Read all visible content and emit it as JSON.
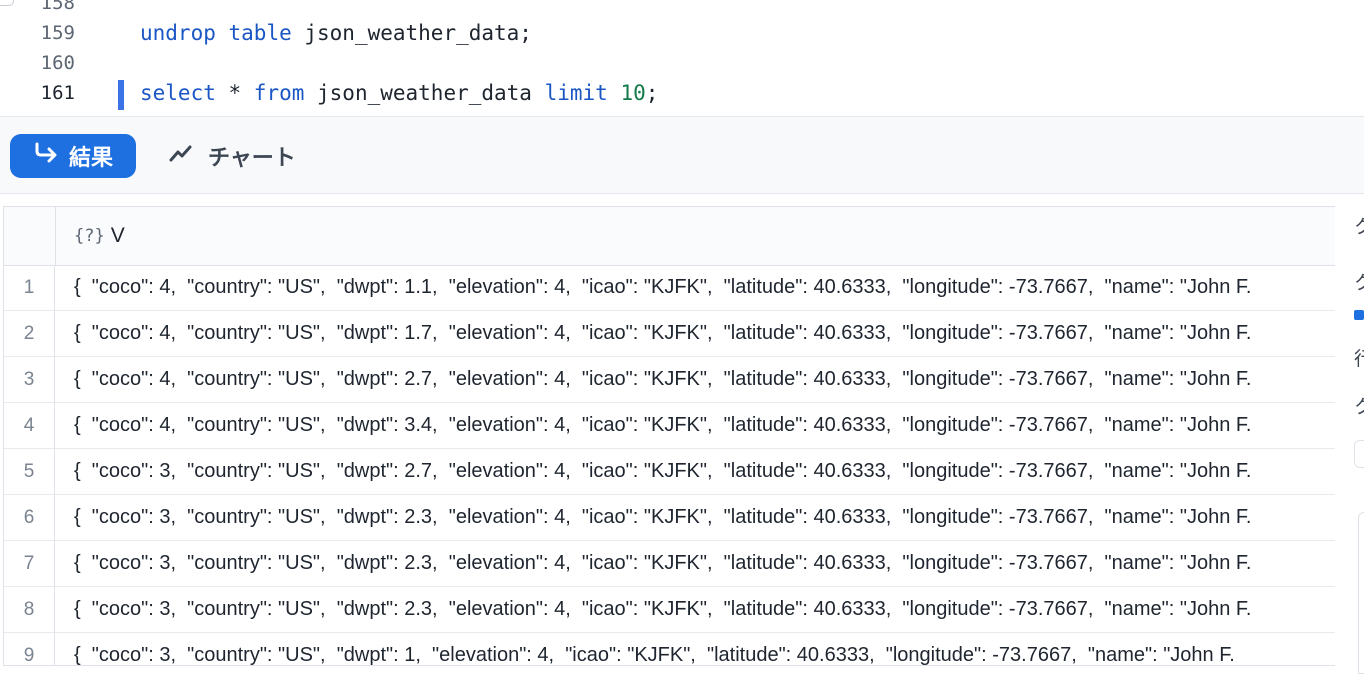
{
  "editor": {
    "lines": [
      {
        "num": "158",
        "tokens": []
      },
      {
        "num": "159",
        "tokens": [
          {
            "text": "undrop",
            "cls": "kw"
          },
          {
            "text": " "
          },
          {
            "text": "table",
            "cls": "kw"
          },
          {
            "text": " json_weather_data;"
          }
        ]
      },
      {
        "num": "160",
        "tokens": []
      },
      {
        "num": "161",
        "tokens": [
          {
            "text": "select",
            "cls": "kw"
          },
          {
            "text": " * "
          },
          {
            "text": "from",
            "cls": "kw"
          },
          {
            "text": " json_weather_data "
          },
          {
            "text": "limit",
            "cls": "kw"
          },
          {
            "text": " "
          },
          {
            "text": "10",
            "cls": "num"
          },
          {
            "text": ";"
          }
        ]
      }
    ],
    "active_line": "161"
  },
  "toolbar": {
    "results_label": "結果",
    "results_icon": "return-arrow-icon",
    "chart_label": "チャート",
    "chart_icon": "trend-line-icon"
  },
  "grid": {
    "column": {
      "type_icon": "{?}",
      "name": "V"
    },
    "rows": [
      {
        "num": "1",
        "value": "{  \"coco\": 4,  \"country\": \"US\",  \"dwpt\": 1.1,  \"elevation\": 4,  \"icao\": \"KJFK\",  \"latitude\": 40.6333,  \"longitude\": -73.7667,  \"name\": \"John F."
      },
      {
        "num": "2",
        "value": "{  \"coco\": 4,  \"country\": \"US\",  \"dwpt\": 1.7,  \"elevation\": 4,  \"icao\": \"KJFK\",  \"latitude\": 40.6333,  \"longitude\": -73.7667,  \"name\": \"John F."
      },
      {
        "num": "3",
        "value": "{  \"coco\": 4,  \"country\": \"US\",  \"dwpt\": 2.7,  \"elevation\": 4,  \"icao\": \"KJFK\",  \"latitude\": 40.6333,  \"longitude\": -73.7667,  \"name\": \"John F."
      },
      {
        "num": "4",
        "value": "{  \"coco\": 4,  \"country\": \"US\",  \"dwpt\": 3.4,  \"elevation\": 4,  \"icao\": \"KJFK\",  \"latitude\": 40.6333,  \"longitude\": -73.7667,  \"name\": \"John F."
      },
      {
        "num": "5",
        "value": "{  \"coco\": 3,  \"country\": \"US\",  \"dwpt\": 2.7,  \"elevation\": 4,  \"icao\": \"KJFK\",  \"latitude\": 40.6333,  \"longitude\": -73.7667,  \"name\": \"John F."
      },
      {
        "num": "6",
        "value": "{  \"coco\": 3,  \"country\": \"US\",  \"dwpt\": 2.3,  \"elevation\": 4,  \"icao\": \"KJFK\",  \"latitude\": 40.6333,  \"longitude\": -73.7667,  \"name\": \"John F."
      },
      {
        "num": "7",
        "value": "{  \"coco\": 3,  \"country\": \"US\",  \"dwpt\": 2.3,  \"elevation\": 4,  \"icao\": \"KJFK\",  \"latitude\": 40.6333,  \"longitude\": -73.7667,  \"name\": \"John F."
      },
      {
        "num": "8",
        "value": "{  \"coco\": 3,  \"country\": \"US\",  \"dwpt\": 2.3,  \"elevation\": 4,  \"icao\": \"KJFK\",  \"latitude\": 40.6333,  \"longitude\": -73.7667,  \"name\": \"John F."
      },
      {
        "num": "9",
        "value": "{  \"coco\": 3,  \"country\": \"US\",  \"dwpt\": 1,  \"elevation\": 4,  \"icao\": \"KJFK\",  \"latitude\": 40.6333,  \"longitude\": -73.7667,  \"name\": \"John F."
      }
    ]
  },
  "side_panel": {
    "glyphs": [
      "ク",
      "ク",
      "行",
      "ク"
    ]
  },
  "colors": {
    "accent": "#1e6fe0",
    "keyword": "#1a56c4",
    "number": "#137a4a",
    "cursor": "#3b73e6"
  }
}
